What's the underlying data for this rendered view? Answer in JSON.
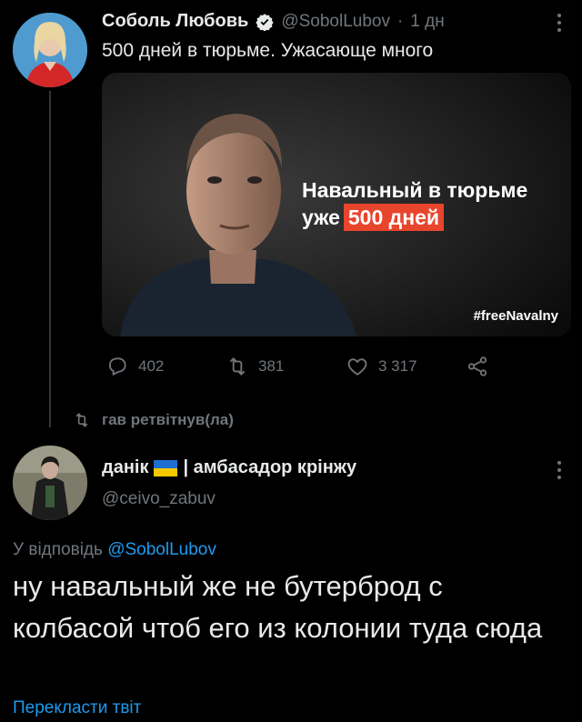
{
  "tweet1": {
    "author_name": "Соболь Любовь",
    "handle": "@SobolLubov",
    "separator": "·",
    "time": "1 дн",
    "text": "500 дней в тюрьме. Ужасающе много",
    "image": {
      "headline_line1": "Навальный в тюрьме",
      "headline_line2_prefix": "уже",
      "headline_highlight": "500 дней",
      "hashtag": "#freeNavalny",
      "highlight_color": "#e8452d"
    },
    "stats": {
      "replies": "402",
      "retweets": "381",
      "likes": "3 317"
    }
  },
  "retweet_notice": "гав ретвітнув(ла)",
  "tweet2": {
    "author_name": "данік",
    "author_name_suffix": "| амбасадор крінжу",
    "handle": "@ceivo_zabuv",
    "reply_prefix": "У відповідь",
    "reply_to": "@SobolLubov",
    "text": "ну навальный же не бутерброд с колбасой чтоб его из колонии туда сюда",
    "translate_link": "Перекласти твіт"
  },
  "colors": {
    "background": "#000000",
    "text": "#e7e9ea",
    "muted": "#71767b",
    "link": "#1d9bf0",
    "line": "#333639"
  }
}
